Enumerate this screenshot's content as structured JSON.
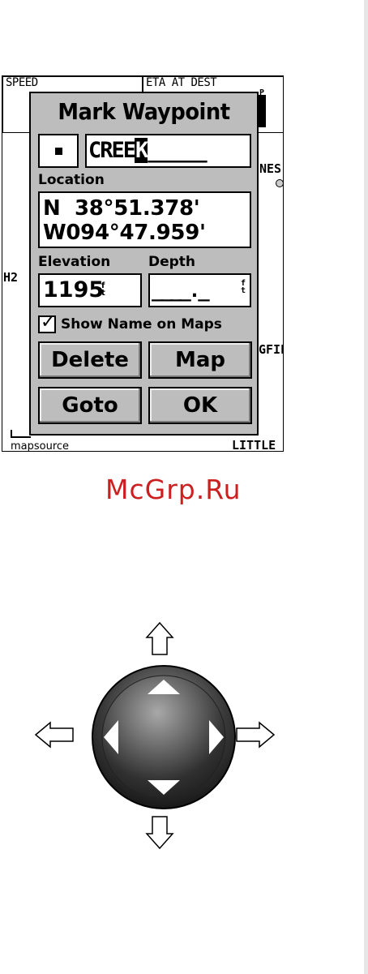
{
  "screen": {
    "speed_label": "SPEED",
    "eta_label": "ETA AT DEST",
    "eta_unit": "P M",
    "map_labels": [
      "NES",
      "H2",
      "GFIE",
      "LITTLE"
    ],
    "source_label": "mapsource"
  },
  "dialog": {
    "title": "Mark Waypoint",
    "name_prefix": "CREE",
    "name_cursor": "K",
    "name_blanks": "_____",
    "location_label": "Location",
    "location_lat": "N  38°51.378'",
    "location_lon": "W094°47.959'",
    "elevation_label": "Elevation",
    "elevation_value": "1195",
    "elevation_unit": "f t",
    "depth_label": "Depth",
    "depth_value": "____._",
    "depth_unit": "f t",
    "show_name_label": "Show Name on Maps",
    "show_name_checked": true,
    "buttons": {
      "delete": "Delete",
      "map": "Map",
      "goto": "Goto",
      "ok": "OK"
    }
  },
  "watermark": "McGrp.Ru",
  "icons": {
    "checkbox": "checkmark-icon",
    "dpad": "rocker-keypad-icon",
    "arrows": [
      "arrow-up-icon",
      "arrow-down-icon",
      "arrow-left-icon",
      "arrow-right-icon"
    ]
  }
}
